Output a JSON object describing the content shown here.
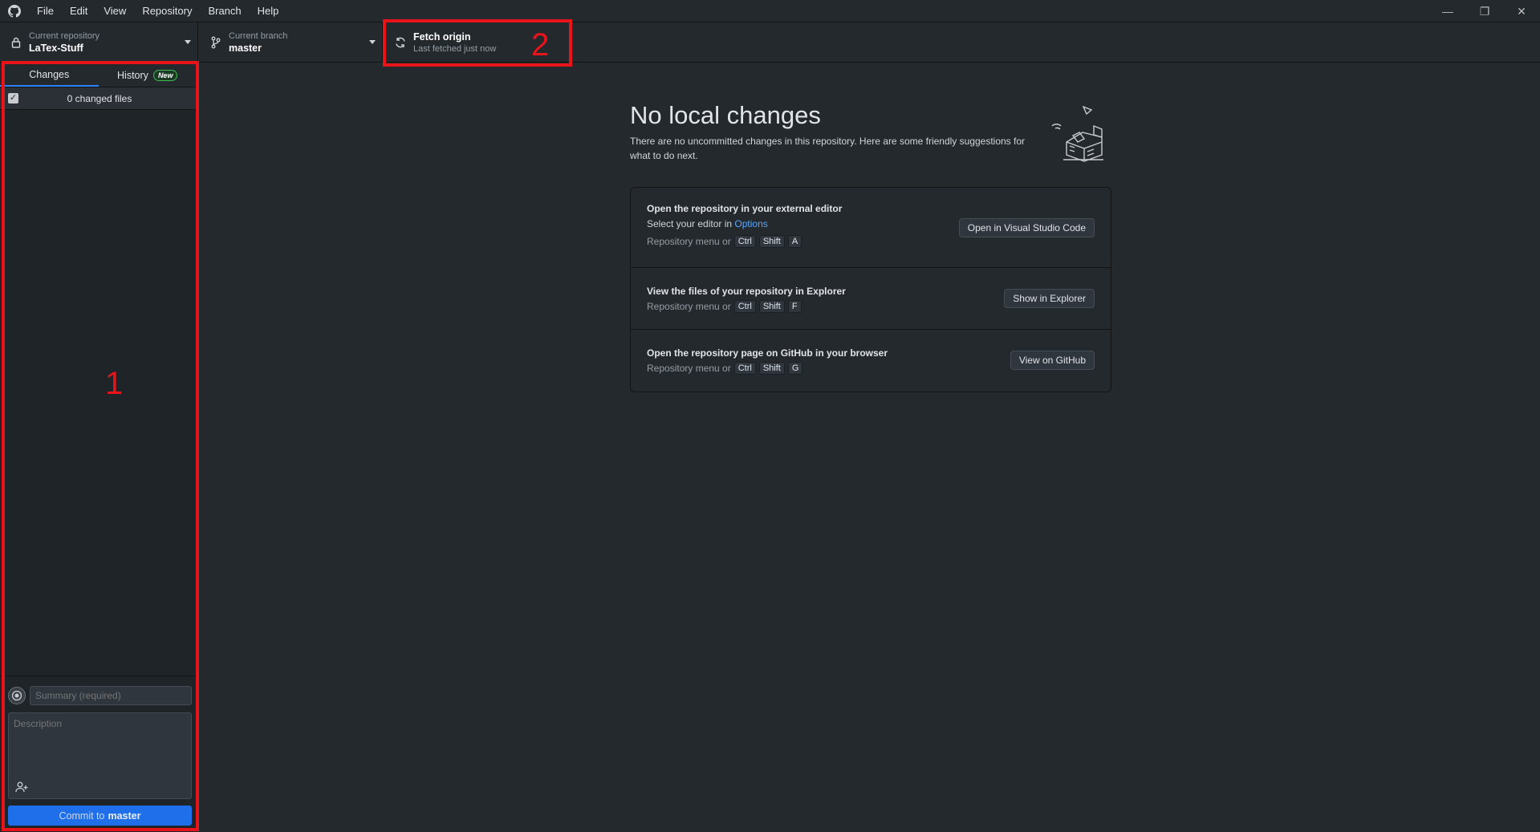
{
  "menu": {
    "items": [
      "File",
      "Edit",
      "View",
      "Repository",
      "Branch",
      "Help"
    ]
  },
  "window_controls": {
    "minimize": "—",
    "restore": "❐",
    "close": "✕"
  },
  "toolbar": {
    "repository": {
      "label": "Current repository",
      "value": "LaTex-Stuff",
      "icon": "lock-icon"
    },
    "branch": {
      "label": "Current branch",
      "value": "master",
      "icon": "branch-icon"
    },
    "fetch": {
      "title": "Fetch origin",
      "subtitle": "Last fetched just now",
      "icon": "sync-icon"
    }
  },
  "sidebar": {
    "tabs": [
      {
        "label": "Changes",
        "active": true
      },
      {
        "label": "History",
        "badge": "New",
        "active": false
      }
    ],
    "changed_files_label": "0 changed files",
    "commit": {
      "summary_placeholder": "Summary (required)",
      "description_placeholder": "Description",
      "button_prefix": "Commit to",
      "button_branch": "master"
    }
  },
  "main": {
    "title": "No local changes",
    "description": "There are no uncommitted changes in this repository. Here are some friendly suggestions for what to do next.",
    "suggestions": [
      {
        "title": "Open the repository in your external editor",
        "line_prefix": "Select your editor in",
        "line_link": "Options",
        "shortcut_prefix": "Repository menu or",
        "keys": [
          "Ctrl",
          "Shift",
          "A"
        ],
        "button": "Open in Visual Studio Code"
      },
      {
        "title": "View the files of your repository in Explorer",
        "shortcut_prefix": "Repository menu or",
        "keys": [
          "Ctrl",
          "Shift",
          "F"
        ],
        "button": "Show in Explorer"
      },
      {
        "title": "Open the repository page on GitHub in your browser",
        "shortcut_prefix": "Repository menu or",
        "keys": [
          "Ctrl",
          "Shift",
          "G"
        ],
        "button": "View on GitHub"
      }
    ]
  },
  "annotations": {
    "box1_label": "1",
    "box2_label": "2",
    "color": "#e8141a"
  },
  "colors": {
    "background": "#24292e",
    "accent": "#1f6feb",
    "link": "#58a6ff"
  }
}
